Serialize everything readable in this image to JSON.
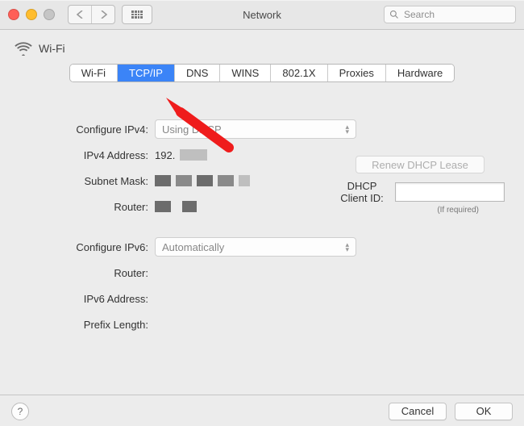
{
  "window": {
    "title": "Network",
    "search_placeholder": "Search"
  },
  "service": {
    "name": "Wi-Fi"
  },
  "tabs": [
    {
      "label": "Wi-Fi",
      "selected": false
    },
    {
      "label": "TCP/IP",
      "selected": true
    },
    {
      "label": "DNS",
      "selected": false
    },
    {
      "label": "WINS",
      "selected": false
    },
    {
      "label": "802.1X",
      "selected": false
    },
    {
      "label": "Proxies",
      "selected": false
    },
    {
      "label": "Hardware",
      "selected": false
    }
  ],
  "ipv4": {
    "configure_label": "Configure IPv4:",
    "configure_value": "Using DHCP",
    "address_label": "IPv4 Address:",
    "address_value": "192.",
    "subnet_label": "Subnet Mask:",
    "router_label": "Router:"
  },
  "dhcp": {
    "renew_label": "Renew DHCP Lease",
    "client_id_label": "DHCP Client ID:",
    "required_note": "(If required)"
  },
  "ipv6": {
    "configure_label": "Configure IPv6:",
    "configure_value": "Automatically",
    "router_label": "Router:",
    "address_label": "IPv6 Address:",
    "prefix_label": "Prefix Length:"
  },
  "footer": {
    "cancel": "Cancel",
    "ok": "OK"
  },
  "annotation": {
    "color": "#ef1c1c"
  }
}
